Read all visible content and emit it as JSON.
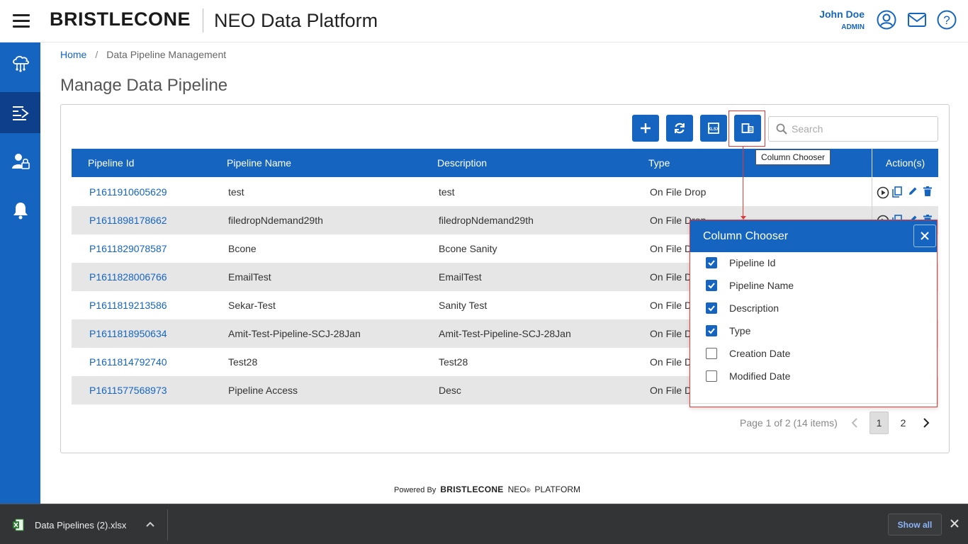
{
  "header": {
    "brand": "BRISTLECONE",
    "title": "NEO Data Platform",
    "user_name": "John Doe",
    "user_role": "ADMIN",
    "icons": [
      "account-circle-icon",
      "mail-icon",
      "help-icon"
    ]
  },
  "sidebar": {
    "items": [
      {
        "name": "cloud-data-icon",
        "active": false
      },
      {
        "name": "pipeline-icon",
        "active": true
      },
      {
        "name": "user-admin-icon",
        "active": false
      },
      {
        "name": "notification-bell-icon",
        "active": false
      }
    ]
  },
  "breadcrumb": {
    "home": "Home",
    "separator": "/",
    "current": "Data Pipeline Management"
  },
  "page_title": "Manage Data Pipeline",
  "toolbar": {
    "buttons": [
      "add-icon",
      "refresh-icon",
      "export-excel-icon",
      "column-chooser-icon"
    ],
    "search_placeholder": "Search",
    "tooltip": "Column Chooser"
  },
  "table": {
    "columns": [
      "Pipeline Id",
      "Pipeline Name",
      "Description",
      "Type",
      "Action(s)"
    ],
    "rows": [
      {
        "id": "P1611910605629",
        "name": "test",
        "description": "test",
        "type": "On File Drop"
      },
      {
        "id": "P1611898178662",
        "name": "filedropNdemand29th",
        "description": "filedropNdemand29th",
        "type": "On File Drop"
      },
      {
        "id": "P1611829078587",
        "name": "Bcone",
        "description": "Bcone Sanity",
        "type": "On File D"
      },
      {
        "id": "P1611828006766",
        "name": "EmailTest",
        "description": "EmailTest",
        "type": "On File D"
      },
      {
        "id": "P1611819213586",
        "name": "Sekar-Test",
        "description": "Sanity Test",
        "type": "On File D"
      },
      {
        "id": "P1611818950634",
        "name": "Amit-Test-Pipeline-SCJ-28Jan",
        "description": "Amit-Test-Pipeline-SCJ-28Jan",
        "type": "On File D"
      },
      {
        "id": "P1611814792740",
        "name": "Test28",
        "description": "Test28",
        "type": "On File D"
      },
      {
        "id": "P1611577568973",
        "name": "Pipeline Access",
        "description": "Desc",
        "type": "On File D"
      }
    ],
    "row_actions": [
      "run-icon",
      "copy-icon",
      "edit-icon",
      "delete-icon"
    ]
  },
  "pagination": {
    "info": "Page 1 of 2 (14 items)",
    "pages": [
      "1",
      "2"
    ],
    "current_page": "1"
  },
  "column_chooser": {
    "title": "Column Chooser",
    "options": [
      {
        "label": "Pipeline Id",
        "checked": true
      },
      {
        "label": "Pipeline Name",
        "checked": true
      },
      {
        "label": "Description",
        "checked": true
      },
      {
        "label": "Type",
        "checked": true
      },
      {
        "label": "Creation Date",
        "checked": false
      },
      {
        "label": "Modified Date",
        "checked": false
      }
    ]
  },
  "footer": {
    "powered_by": "Powered By",
    "brand": "BRISTLECONE",
    "neo": "NEO",
    "registered": "®",
    "platform": "PLATFORM"
  },
  "download_bar": {
    "file_name": "Data Pipelines (2).xlsx",
    "show_all": "Show all"
  },
  "colors": {
    "primary": "#1565c0",
    "sidebar_active": "#0d3f8a",
    "highlight": "#e53935",
    "row_alt": "#e6e6e6"
  }
}
